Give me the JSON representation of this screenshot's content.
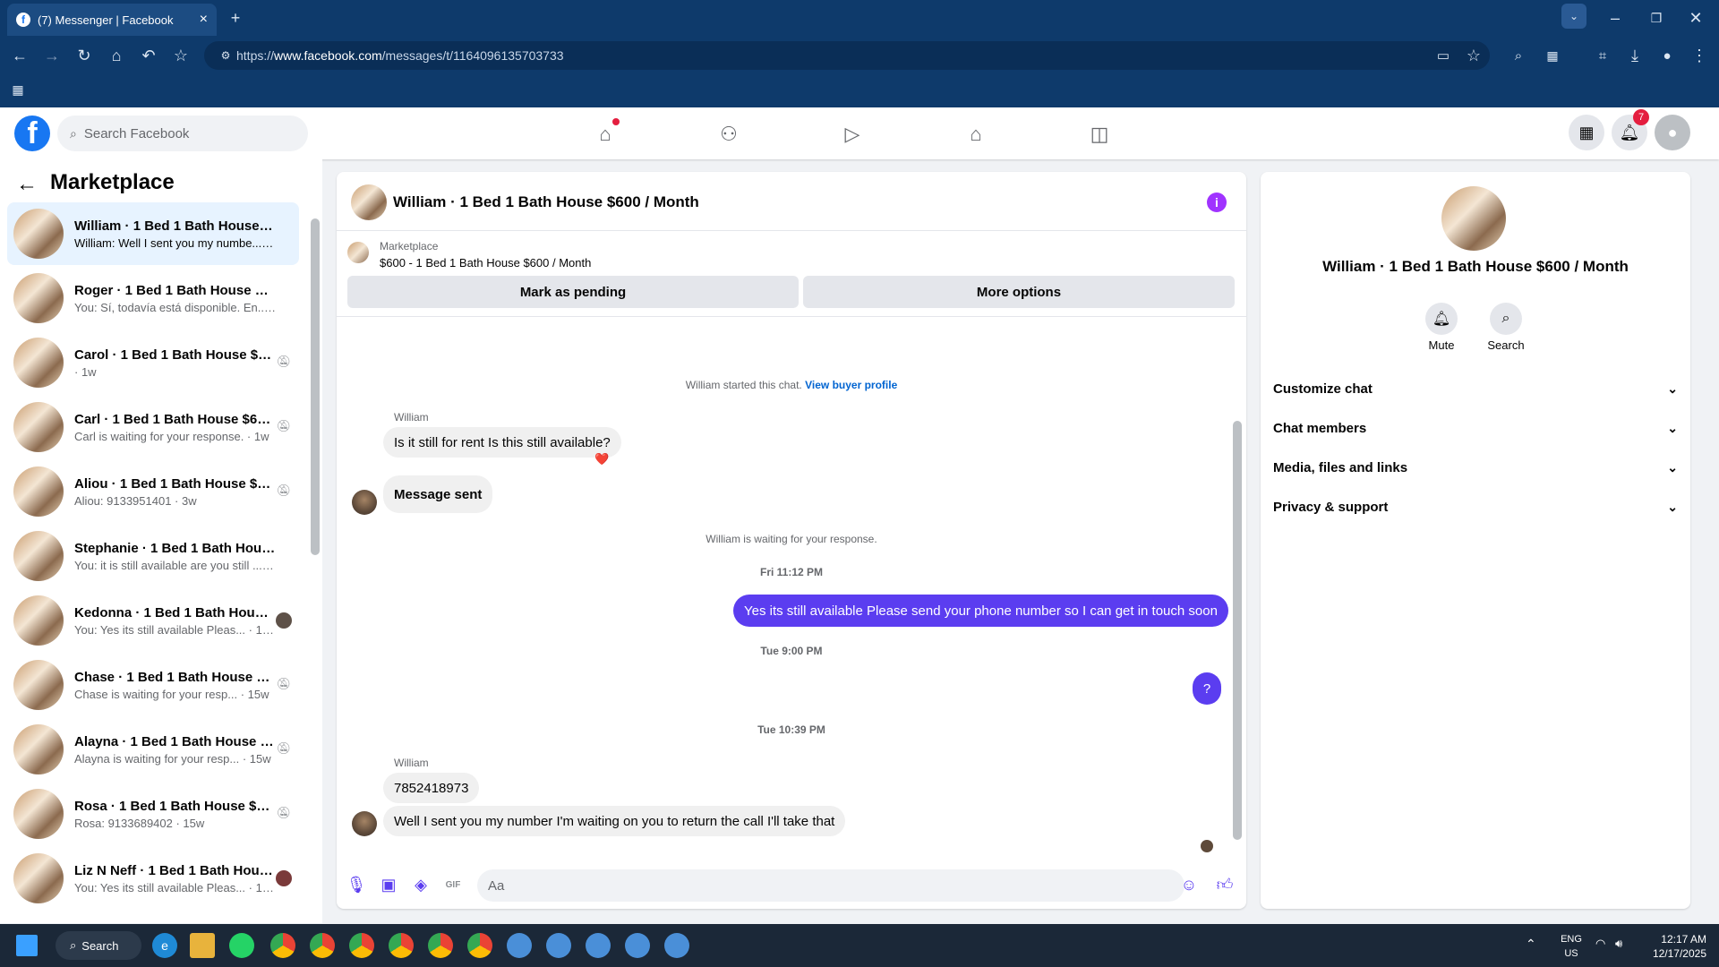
{
  "browser": {
    "tab_title": "(7) Messenger | Facebook",
    "url_prefix": "https://",
    "url_host": "www.facebook.com",
    "url_path": "/messages/t/1164096135703733"
  },
  "fb_header": {
    "search_placeholder": "Search Facebook",
    "notification_count": "7"
  },
  "left_panel": {
    "title": "Marketplace",
    "conversations": [
      {
        "name": "William · 1 Bed 1 Bath House $6...",
        "preview": "William: Well I sent you my numbe... · 1h"
      },
      {
        "name": "Roger · 1 Bed 1 Bath House $600...",
        "preview": "You: Sí, todavía está disponible. En... · 3h"
      },
      {
        "name": "Carol · 1 Bed 1 Bath House $6...",
        "preview": "· 1w"
      },
      {
        "name": "Carl · 1 Bed 1 Bath House $60...",
        "preview": "Carl is waiting for your response. · 1w"
      },
      {
        "name": "Aliou · 1 Bed 1 Bath House $6...",
        "preview": "Aliou: 9133951401 · 3w"
      },
      {
        "name": "Stephanie · 1 Bed 1 Bath House ...",
        "preview": "You: it is still available are you still ... · 3w"
      },
      {
        "name": "Kedonna · 1 Bed 1 Bath House...",
        "preview": "You: Yes its still available Pleas... · 15w"
      },
      {
        "name": "Chase · 1 Bed 1 Bath House $6...",
        "preview": "Chase is waiting for your resp... · 15w"
      },
      {
        "name": "Alayna · 1 Bed 1 Bath House $...",
        "preview": "Alayna is waiting for your resp... · 15w"
      },
      {
        "name": "Rosa · 1 Bed 1 Bath House $60...",
        "preview": "Rosa: 9133689402 · 15w"
      },
      {
        "name": "Liz N Neff · 1 Bed 1 Bath Hous...",
        "preview": "You: Yes its still available Pleas... · 15w"
      }
    ]
  },
  "chat": {
    "title": "William · 1 Bed 1 Bath House $600 / Month",
    "marketplace_label": "Marketplace",
    "listing": "$600 - 1 Bed 1 Bath House $600 / Month",
    "mark_pending": "Mark as pending",
    "more_options": "More options",
    "started_text": "William started this chat.",
    "view_buyer_profile": "View buyer profile",
    "sender_name_1": "William",
    "msg_1": "Is it still for rent Is this still available?",
    "reaction_1": "❤️",
    "msg_2": "Message sent",
    "waiting_text": "William is waiting for your response.",
    "time_1": "Fri 11:12 PM",
    "msg_3": "Yes its still available Please send your phone number so I can get in touch soon",
    "time_2": "Tue 9:00 PM",
    "msg_4": "?",
    "time_3": "Tue 10:39 PM",
    "sender_name_2": "William",
    "msg_5": "7852418973",
    "msg_6": "Well I sent you my number I'm waiting on you to return the call I'll take that",
    "composer_placeholder": "Aa"
  },
  "right_panel": {
    "title": "William · 1 Bed 1 Bath House $600 / Month",
    "mute_label": "Mute",
    "search_label": "Search",
    "sections": [
      "Customize chat",
      "Chat members",
      "Media, files and links",
      "Privacy & support"
    ]
  },
  "taskbar": {
    "search_label": "Search",
    "lang_1": "ENG",
    "lang_2": "US",
    "time": "12:17 AM",
    "date": "12/17/2025"
  },
  "colors": {
    "fb_blue": "#1877f2",
    "sent_bubble": "#5b3df0",
    "browser_frame": "#0e3a6b"
  }
}
